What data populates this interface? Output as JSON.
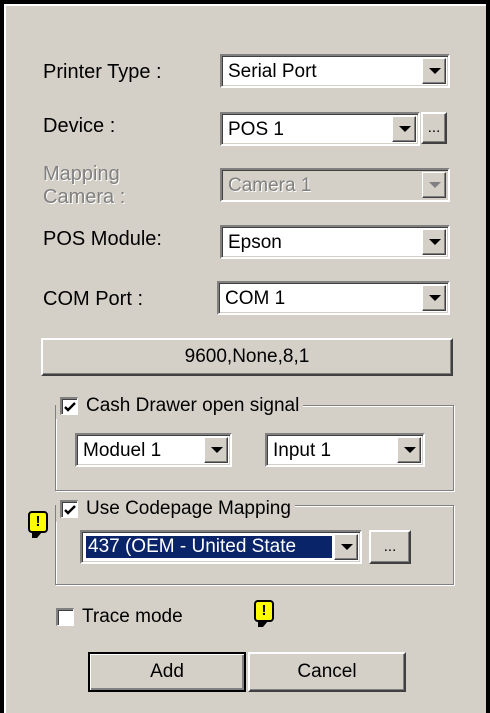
{
  "form": {
    "printer_type_label": "Printer Type :",
    "printer_type_value": "Serial Port",
    "device_label": "Device :",
    "device_value": "POS 1",
    "device_browse": "...",
    "mapping_camera_label_line1": "Mapping",
    "mapping_camera_label_line2": "Camera :",
    "mapping_camera_value": "Camera 1",
    "pos_module_label": "POS Module:",
    "pos_module_value": "Epson",
    "com_port_label": "COM Port :",
    "com_port_value": "COM 1",
    "serial_settings_button": "9600,None,8,1"
  },
  "cash_drawer": {
    "checked": true,
    "label": "Cash Drawer open signal",
    "module_value": "Moduel 1",
    "input_value": "Input 1"
  },
  "codepage": {
    "checked": true,
    "label": "Use Codepage Mapping",
    "value": "437  (OEM - United State",
    "browse": "..."
  },
  "trace": {
    "checked": false,
    "label": "Trace mode"
  },
  "warning_glyph": "!",
  "buttons": {
    "add": "Add",
    "cancel": "Cancel"
  },
  "colors": {
    "background": "#d4d0c8",
    "selection": "#0a246a",
    "warning": "#ffff00"
  }
}
